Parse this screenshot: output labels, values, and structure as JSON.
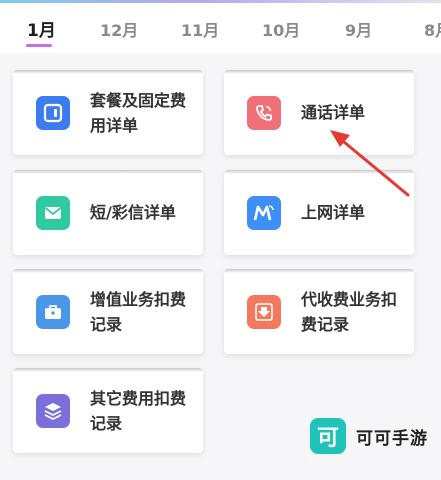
{
  "tabs": [
    {
      "label": "1月",
      "active": true
    },
    {
      "label": "12月",
      "active": false
    },
    {
      "label": "11月",
      "active": false
    },
    {
      "label": "10月",
      "active": false
    },
    {
      "label": "9月",
      "active": false
    },
    {
      "label": "8月",
      "active": false
    }
  ],
  "cards": [
    {
      "label": "套餐及固定费用详单",
      "icon": "package-icon",
      "color": "#3d7cf0"
    },
    {
      "label": "通话详单",
      "icon": "phone-call-icon",
      "color": "#f0707a"
    },
    {
      "label": "短/彩信详单",
      "icon": "envelope-icon",
      "color": "#2fc9a2"
    },
    {
      "label": "上网详单",
      "icon": "internet-m-icon",
      "color": "#3d8ef5"
    },
    {
      "label": "增值业务扣费记录",
      "icon": "toolbox-icon",
      "color": "#4a96e9"
    },
    {
      "label": "代收费业务扣费记录",
      "icon": "download-tray-icon",
      "color": "#f07a5b"
    },
    {
      "label": "其它费用扣费记录",
      "icon": "layers-icon",
      "color": "#7b6fdb"
    }
  ],
  "watermark": {
    "logo_char": "可",
    "text": "可可手游"
  },
  "colors": {
    "tab_underline": "#c56fe0",
    "annotation_arrow": "#e53935"
  }
}
